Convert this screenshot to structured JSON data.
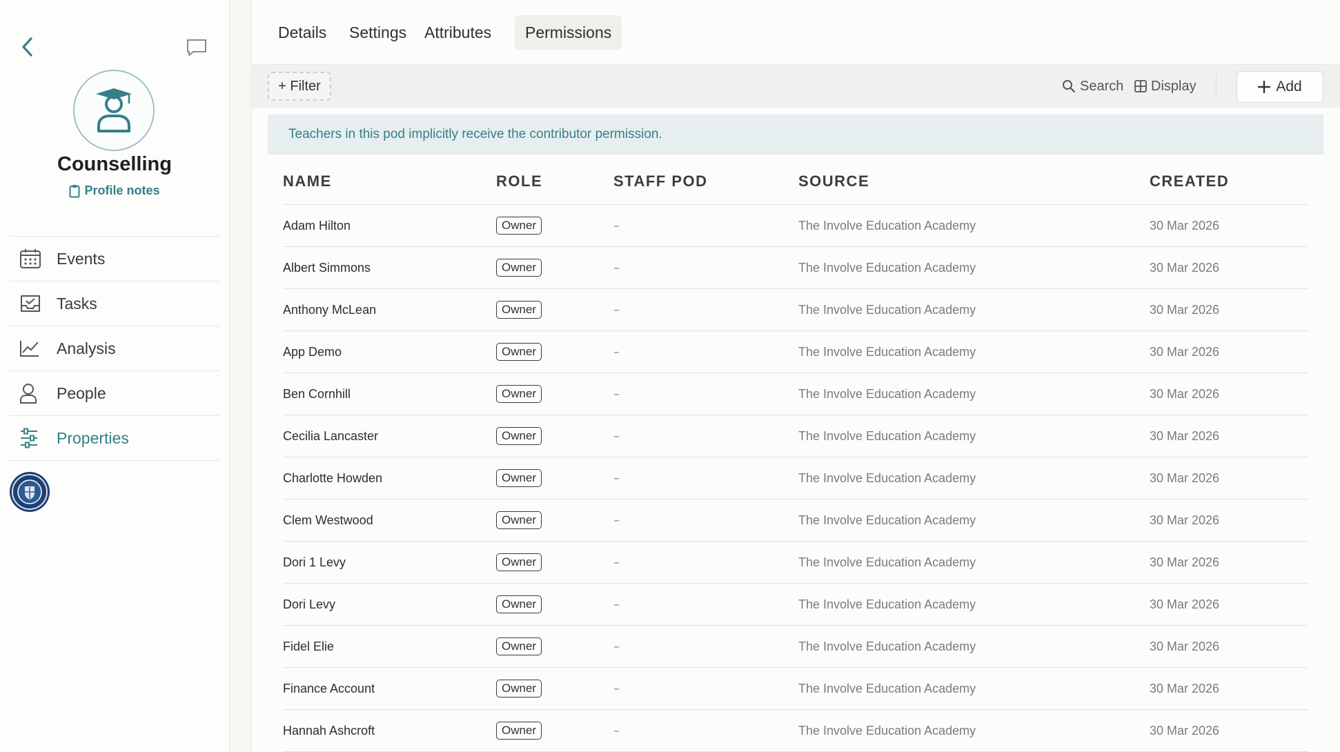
{
  "sidebar": {
    "pod_name": "Counselling",
    "profile_notes_label": "Profile notes",
    "nav": [
      {
        "label": "Events",
        "icon": "calendar-icon",
        "active": false
      },
      {
        "label": "Tasks",
        "icon": "tasks-tray-icon",
        "active": false
      },
      {
        "label": "Analysis",
        "icon": "line-chart-icon",
        "active": false
      },
      {
        "label": "People",
        "icon": "person-icon",
        "active": false
      },
      {
        "label": "Properties",
        "icon": "sliders-icon",
        "active": true
      }
    ],
    "accent_color": "#367f89"
  },
  "tabs": [
    {
      "label": "Details",
      "active": false
    },
    {
      "label": "Settings",
      "active": false
    },
    {
      "label": "Attributes",
      "active": false
    },
    {
      "label": "Permissions",
      "active": true
    }
  ],
  "toolbar": {
    "filter_label": "+ Filter",
    "search_label": "Search",
    "display_label": "Display",
    "add_label": "Add"
  },
  "banner": {
    "text": "Teachers in this pod implicitly receive the contributor permission."
  },
  "table": {
    "columns": [
      "NAME",
      "ROLE",
      "STAFF POD",
      "SOURCE",
      "CREATED"
    ],
    "rows": [
      {
        "name": "Adam Hilton",
        "role": "Owner",
        "staff_pod": "–",
        "source": "The Involve Education Academy",
        "created": "30 Mar 2026"
      },
      {
        "name": "Albert Simmons",
        "role": "Owner",
        "staff_pod": "–",
        "source": "The Involve Education Academy",
        "created": "30 Mar 2026"
      },
      {
        "name": "Anthony McLean",
        "role": "Owner",
        "staff_pod": "–",
        "source": "The Involve Education Academy",
        "created": "30 Mar 2026"
      },
      {
        "name": "App Demo",
        "role": "Owner",
        "staff_pod": "–",
        "source": "The Involve Education Academy",
        "created": "30 Mar 2026"
      },
      {
        "name": "Ben Cornhill",
        "role": "Owner",
        "staff_pod": "–",
        "source": "The Involve Education Academy",
        "created": "30 Mar 2026"
      },
      {
        "name": "Cecilia Lancaster",
        "role": "Owner",
        "staff_pod": "–",
        "source": "The Involve Education Academy",
        "created": "30 Mar 2026"
      },
      {
        "name": "Charlotte Howden",
        "role": "Owner",
        "staff_pod": "–",
        "source": "The Involve Education Academy",
        "created": "30 Mar 2026"
      },
      {
        "name": "Clem Westwood",
        "role": "Owner",
        "staff_pod": "–",
        "source": "The Involve Education Academy",
        "created": "30 Mar 2026"
      },
      {
        "name": "Dori 1 Levy",
        "role": "Owner",
        "staff_pod": "–",
        "source": "The Involve Education Academy",
        "created": "30 Mar 2026"
      },
      {
        "name": "Dori Levy",
        "role": "Owner",
        "staff_pod": "–",
        "source": "The Involve Education Academy",
        "created": "30 Mar 2026"
      },
      {
        "name": "Fidel Elie",
        "role": "Owner",
        "staff_pod": "–",
        "source": "The Involve Education Academy",
        "created": "30 Mar 2026"
      },
      {
        "name": "Finance Account",
        "role": "Owner",
        "staff_pod": "–",
        "source": "The Involve Education Academy",
        "created": "30 Mar 2026"
      },
      {
        "name": "Hannah Ashcroft",
        "role": "Owner",
        "staff_pod": "–",
        "source": "The Involve Education Academy",
        "created": "30 Mar 2026"
      }
    ]
  }
}
